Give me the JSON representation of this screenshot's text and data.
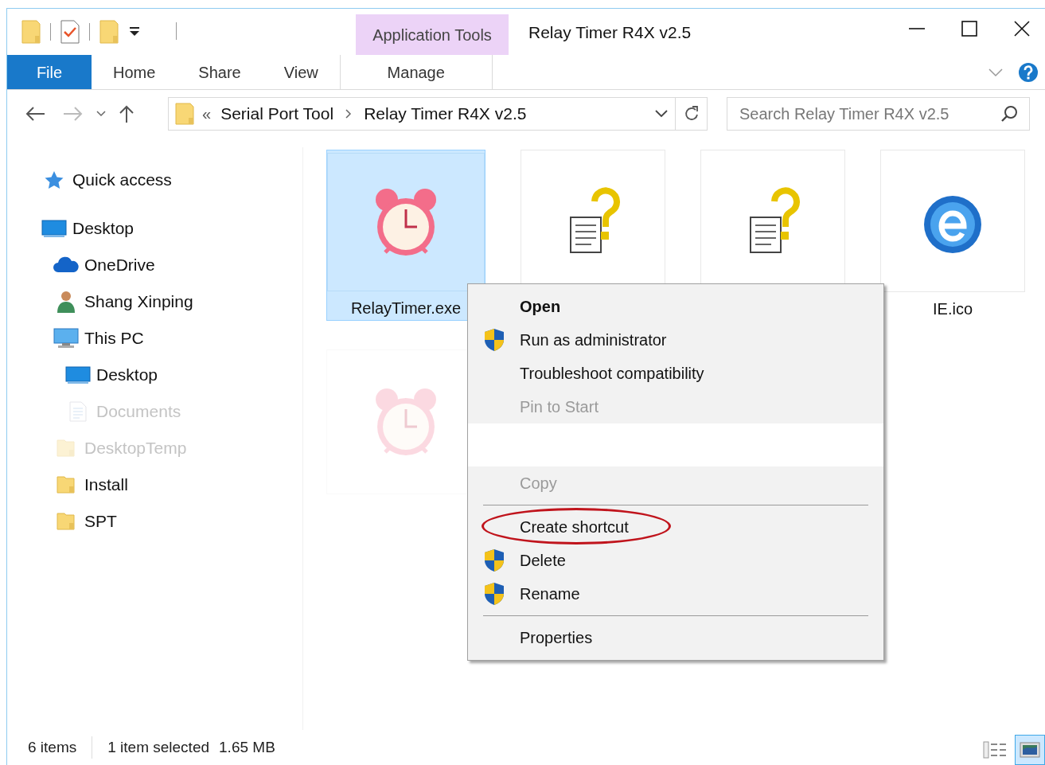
{
  "window": {
    "title": "Relay Timer R4X v2.5"
  },
  "quick_access_toolbar": [
    {
      "kind": "folder"
    },
    {
      "kind": "properties"
    },
    {
      "kind": "new-folder"
    },
    {
      "kind": "customize"
    }
  ],
  "contextual_group": {
    "label": "Application Tools"
  },
  "ribbon_tabs": [
    {
      "label": "File",
      "kind": "file"
    },
    {
      "label": "Home",
      "kind": "tab"
    },
    {
      "label": "Share",
      "kind": "tab"
    },
    {
      "label": "View",
      "kind": "tab"
    },
    {
      "label": "Manage",
      "kind": "contextual"
    }
  ],
  "address_bar": {
    "overflow": "«",
    "path": [
      "Serial Port Tool",
      "Relay Timer R4X v2.5"
    ]
  },
  "search": {
    "placeholder": "Search Relay Timer R4X v2.5"
  },
  "navigation": [
    {
      "label": "Quick access",
      "kind": "star",
      "faded": false
    },
    {
      "label": "Desktop",
      "kind": "desktop",
      "faded": false,
      "children": [
        {
          "label": "OneDrive",
          "kind": "cloud",
          "faded": false
        },
        {
          "label": "Shang Xinping",
          "kind": "user",
          "faded": false
        },
        {
          "label": "This PC",
          "kind": "pc",
          "faded": false,
          "children": [
            {
              "label": "Desktop",
              "kind": "desktop",
              "faded": false
            },
            {
              "label": "Documents",
              "kind": "document",
              "faded": true
            }
          ]
        },
        {
          "label": "DesktopTemp",
          "kind": "folder",
          "faded": true
        },
        {
          "label": "Install",
          "kind": "folder",
          "faded": false
        },
        {
          "label": "SPT",
          "kind": "folder",
          "faded": false
        }
      ]
    }
  ],
  "files": [
    {
      "label": "RelayTimer.exe",
      "kind": "clock",
      "selected": true,
      "faded": false
    },
    {
      "kind": "unknown",
      "selected": false,
      "faded": false
    },
    {
      "kind": "unknown",
      "selected": false,
      "faded": false
    },
    {
      "label": "IE.ico",
      "kind": "browser",
      "selected": false,
      "faded": false
    },
    {
      "kind": "clock",
      "selected": false,
      "faded": true
    }
  ],
  "context_menu": [
    {
      "kind": "item",
      "label": "Open",
      "bold": true,
      "shield": false,
      "faded": false,
      "circled": false
    },
    {
      "kind": "item",
      "label": "Run as administrator",
      "bold": false,
      "shield": true,
      "faded": false,
      "circled": false
    },
    {
      "kind": "item",
      "label": "Troubleshoot compatibility",
      "bold": false,
      "shield": false,
      "faded": false,
      "circled": false
    },
    {
      "kind": "item",
      "label": "Pin to Start",
      "bold": false,
      "shield": false,
      "faded": true,
      "circled": false
    },
    {
      "kind": "gap"
    },
    {
      "kind": "item",
      "label": "Copy",
      "bold": false,
      "shield": false,
      "faded": true,
      "circled": false
    },
    {
      "kind": "separator"
    },
    {
      "kind": "item",
      "label": "Create shortcut",
      "bold": false,
      "shield": false,
      "faded": false,
      "circled": true
    },
    {
      "kind": "item",
      "label": "Delete",
      "bold": false,
      "shield": true,
      "faded": false,
      "circled": false
    },
    {
      "kind": "item",
      "label": "Rename",
      "bold": false,
      "shield": true,
      "faded": false,
      "circled": false
    },
    {
      "kind": "separator"
    },
    {
      "kind": "item",
      "label": "Properties",
      "bold": false,
      "shield": false,
      "faded": false,
      "circled": false
    }
  ],
  "status_bar": {
    "item_count": "6 items",
    "selection": "1 item selected",
    "size": "1.65 MB"
  },
  "view_buttons": [
    {
      "kind": "details",
      "selected": false
    },
    {
      "kind": "large-icons",
      "selected": true
    }
  ]
}
